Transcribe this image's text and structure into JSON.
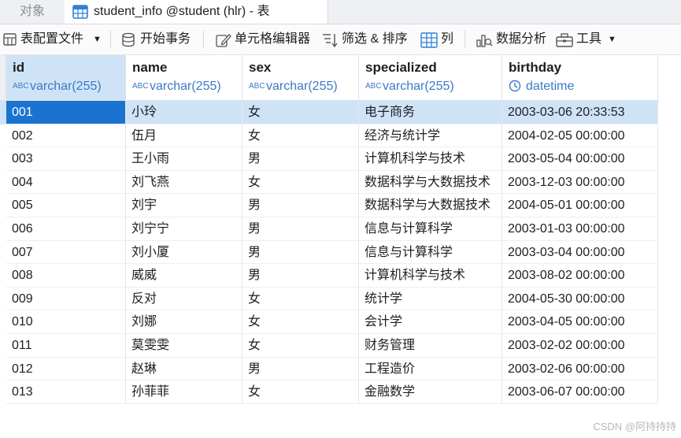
{
  "tabs": {
    "objects_label": "对象",
    "active_label": "student_info @student (hlr) - 表"
  },
  "toolbar": {
    "table_config": "表配置文件",
    "begin_transaction": "开始事务",
    "cell_editor": "单元格编辑器",
    "filter_sort": "筛选 & 排序",
    "columns": "列",
    "data_analysis": "数据分析",
    "tools": "工具"
  },
  "columns": [
    {
      "name": "id",
      "type": "varchar(255)",
      "type_icon": "text-type-icon"
    },
    {
      "name": "name",
      "type": "varchar(255)",
      "type_icon": "text-type-icon"
    },
    {
      "name": "sex",
      "type": "varchar(255)",
      "type_icon": "text-type-icon"
    },
    {
      "name": "specialized",
      "type": "varchar(255)",
      "type_icon": "text-type-icon"
    },
    {
      "name": "birthday",
      "type": "datetime",
      "type_icon": "clock-icon"
    }
  ],
  "rows": [
    [
      "001",
      "小玲",
      "女",
      "电子商务",
      "2003-03-06 20:33:53"
    ],
    [
      "002",
      "伍月",
      "女",
      "经济与统计学",
      "2004-02-05 00:00:00"
    ],
    [
      "003",
      "王小雨",
      "男",
      "计算机科学与技术",
      "2003-05-04 00:00:00"
    ],
    [
      "004",
      "刘飞燕",
      "女",
      "数据科学与大数据技术",
      "2003-12-03 00:00:00"
    ],
    [
      "005",
      "刘宇",
      "男",
      "数据科学与大数据技术",
      "2004-05-01 00:00:00"
    ],
    [
      "006",
      "刘宁宁",
      "男",
      "信息与计算科学",
      "2003-01-03 00:00:00"
    ],
    [
      "007",
      "刘小厦",
      "男",
      "信息与计算科学",
      "2003-03-04 00:00:00"
    ],
    [
      "008",
      "威威",
      "男",
      "计算机科学与技术",
      "2003-08-02 00:00:00"
    ],
    [
      "009",
      "反对",
      "女",
      "统计学",
      "2004-05-30 00:00:00"
    ],
    [
      "010",
      "刘娜",
      "女",
      "会计学",
      "2003-04-05 00:00:00"
    ],
    [
      "011",
      "莫雯雯",
      "女",
      "财务管理",
      "2003-02-02 00:00:00"
    ],
    [
      "012",
      "赵琳",
      "男",
      "工程造价",
      "2003-02-06 00:00:00"
    ],
    [
      "013",
      "孙菲菲",
      "女",
      "金融数学",
      "2003-06-07 00:00:00"
    ]
  ],
  "watermark": "CSDN @阿持持持",
  "colors": {
    "selection": "#1a73d1",
    "row_highlight": "#cfe3f7",
    "type_text": "#3c79c4"
  }
}
